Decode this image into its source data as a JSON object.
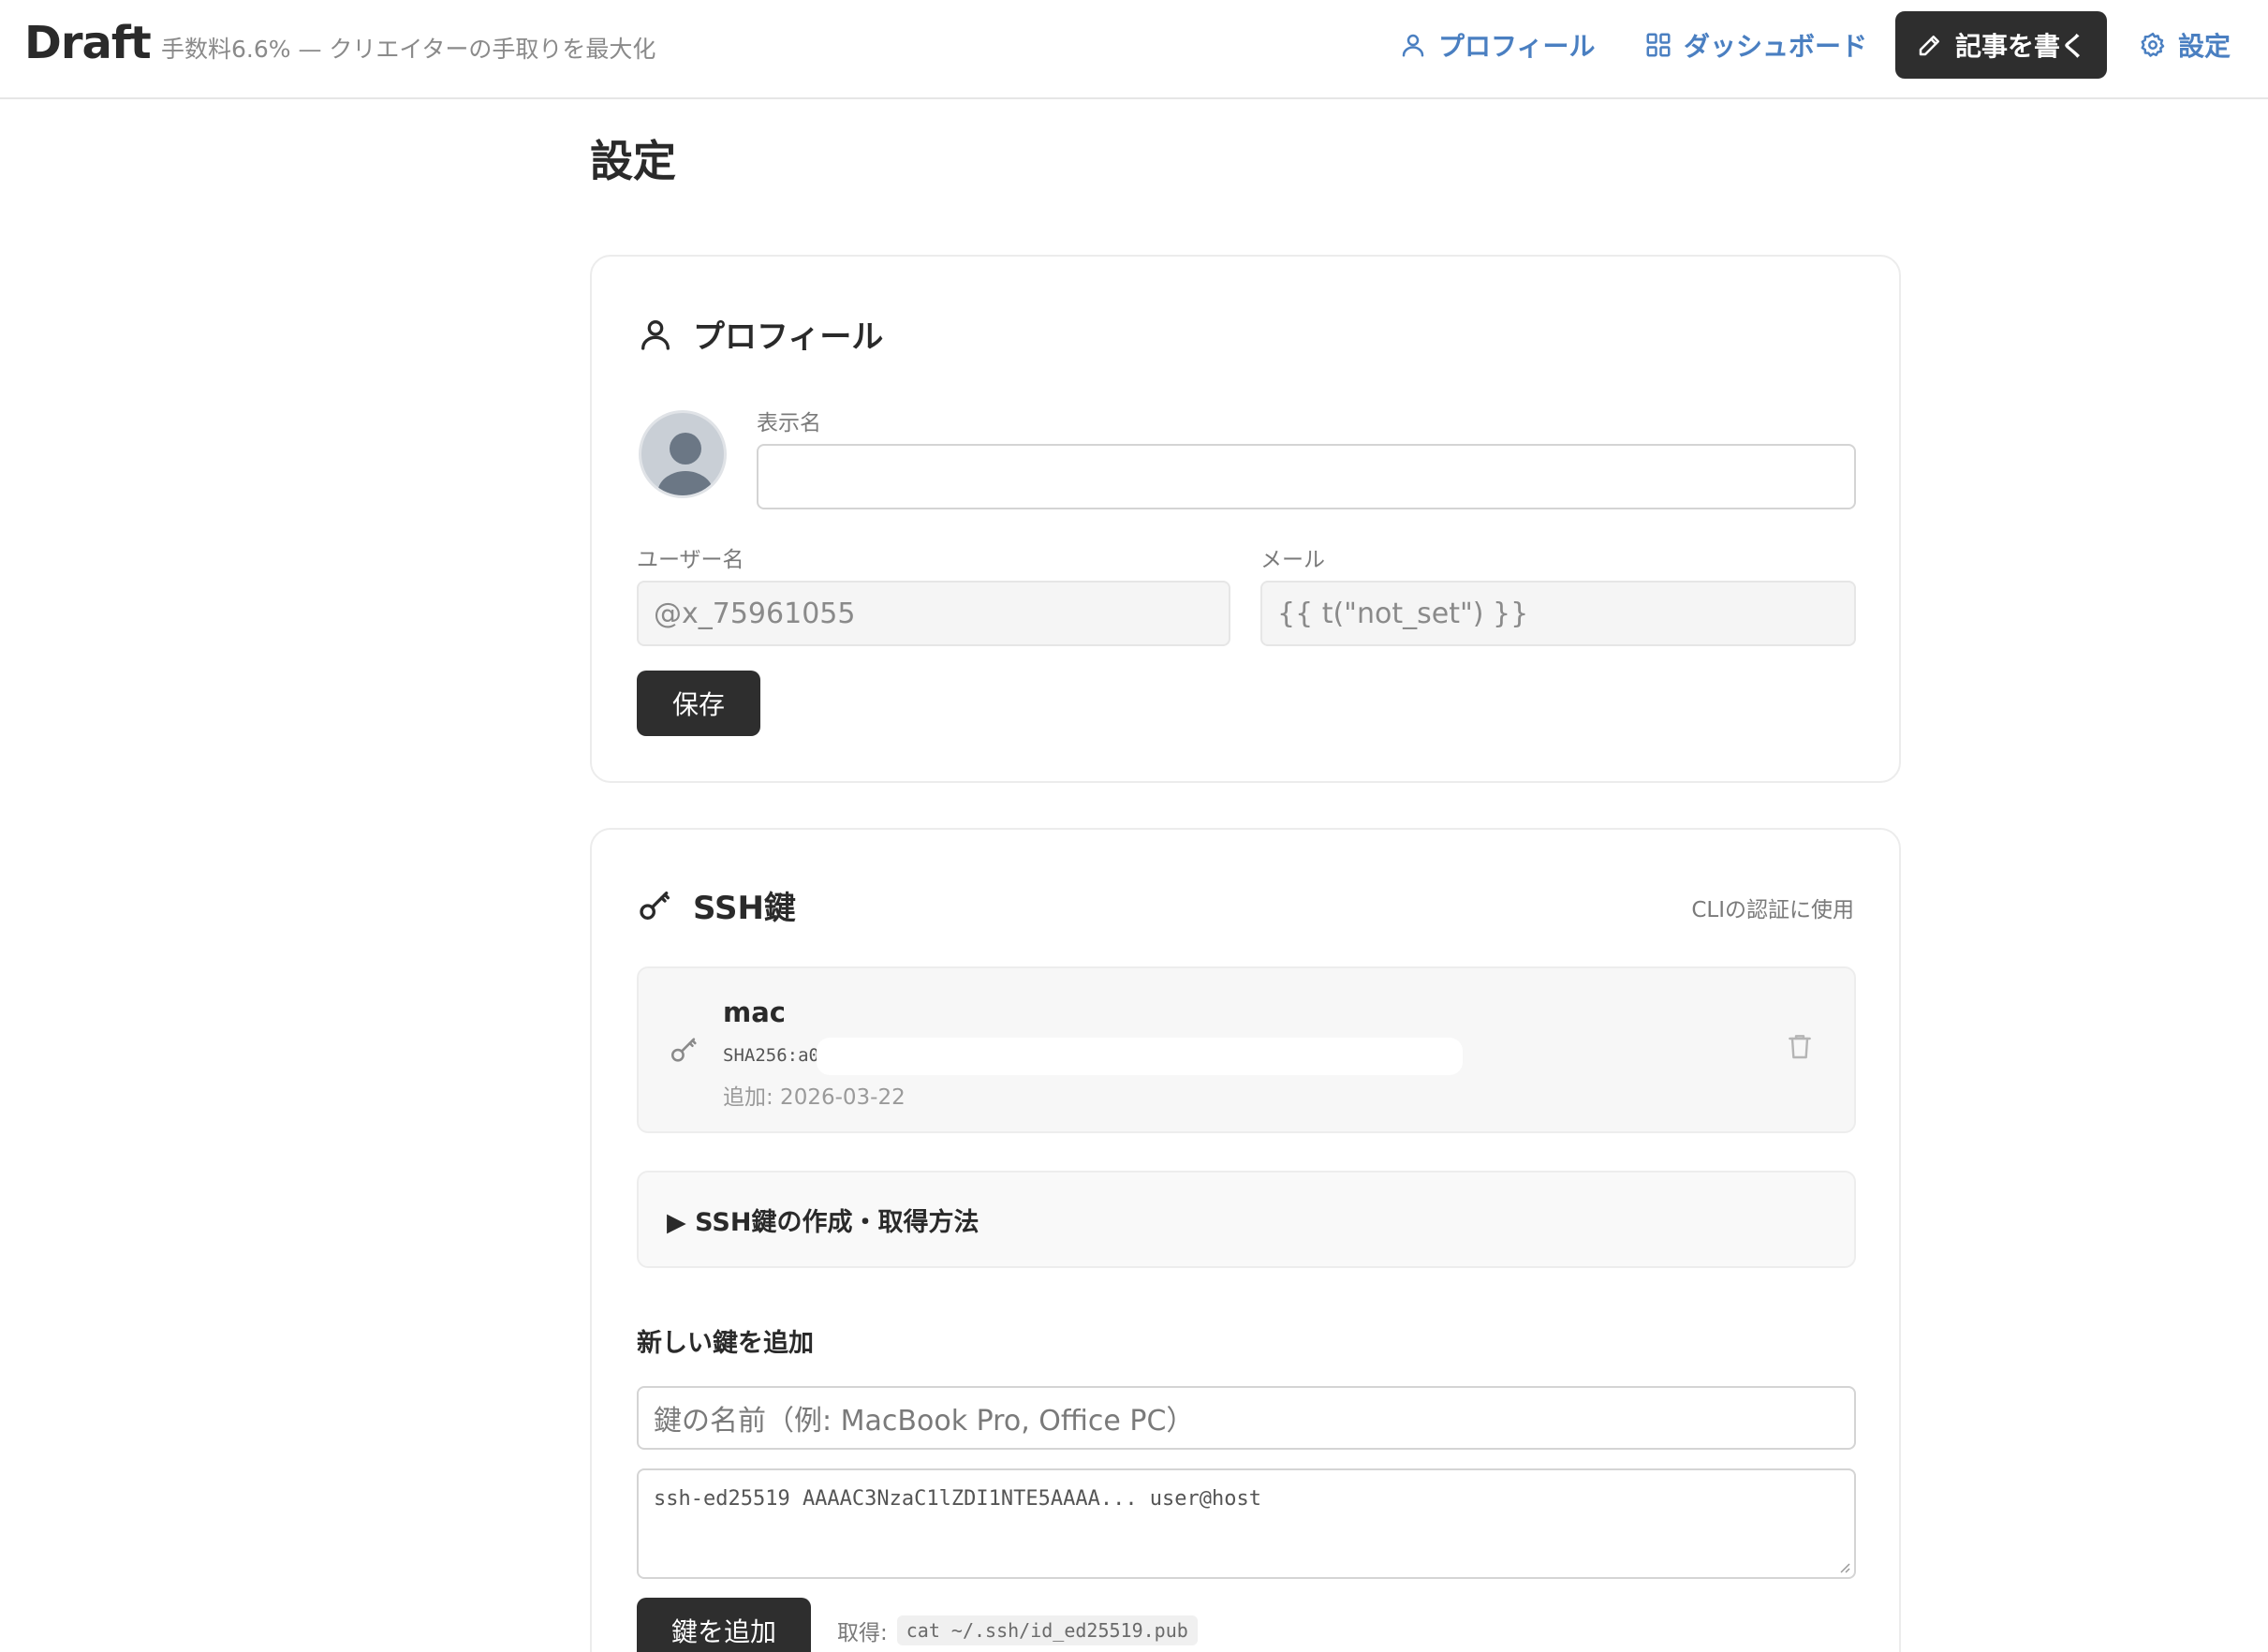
{
  "header": {
    "logo": "Draft",
    "tagline": "手数料6.6% — クリエイターの手取りを最大化",
    "nav": {
      "profile": "プロフィール",
      "dashboard": "ダッシュボード",
      "write": "記事を書く",
      "settings": "設定"
    }
  },
  "page": {
    "title": "設定"
  },
  "profile_section": {
    "heading": "プロフィール",
    "display_name_label": "表示名",
    "display_name_value": "",
    "username_label": "ユーザー名",
    "username_value": "@x_75961055",
    "email_label": "メール",
    "email_value": "{{ t(\"not_set\") }}",
    "save_label": "保存"
  },
  "ssh_section": {
    "heading": "SSH鍵",
    "note": "CLIの認証に使用",
    "keys": [
      {
        "name": "mac",
        "fingerprint": "SHA256:a0",
        "added": "追加: 2026-03-22"
      }
    ],
    "howto_label": "▶ SSH鍵の作成・取得方法",
    "add_heading": "新しい鍵を追加",
    "key_name_placeholder": "鍵の名前（例: MacBook Pro, Office PC）",
    "key_body_placeholder": "ssh-ed25519 AAAAC3NzaC1lZDI1NTE5AAAA... user@host",
    "add_button": "鍵を追加",
    "fetch_label": "取得:",
    "fetch_command": "cat ~/.ssh/id_ed25519.pub"
  },
  "colors": {
    "accent": "#4a7fc1",
    "dark_button": "#2e2e2e",
    "border": "#ececec"
  }
}
